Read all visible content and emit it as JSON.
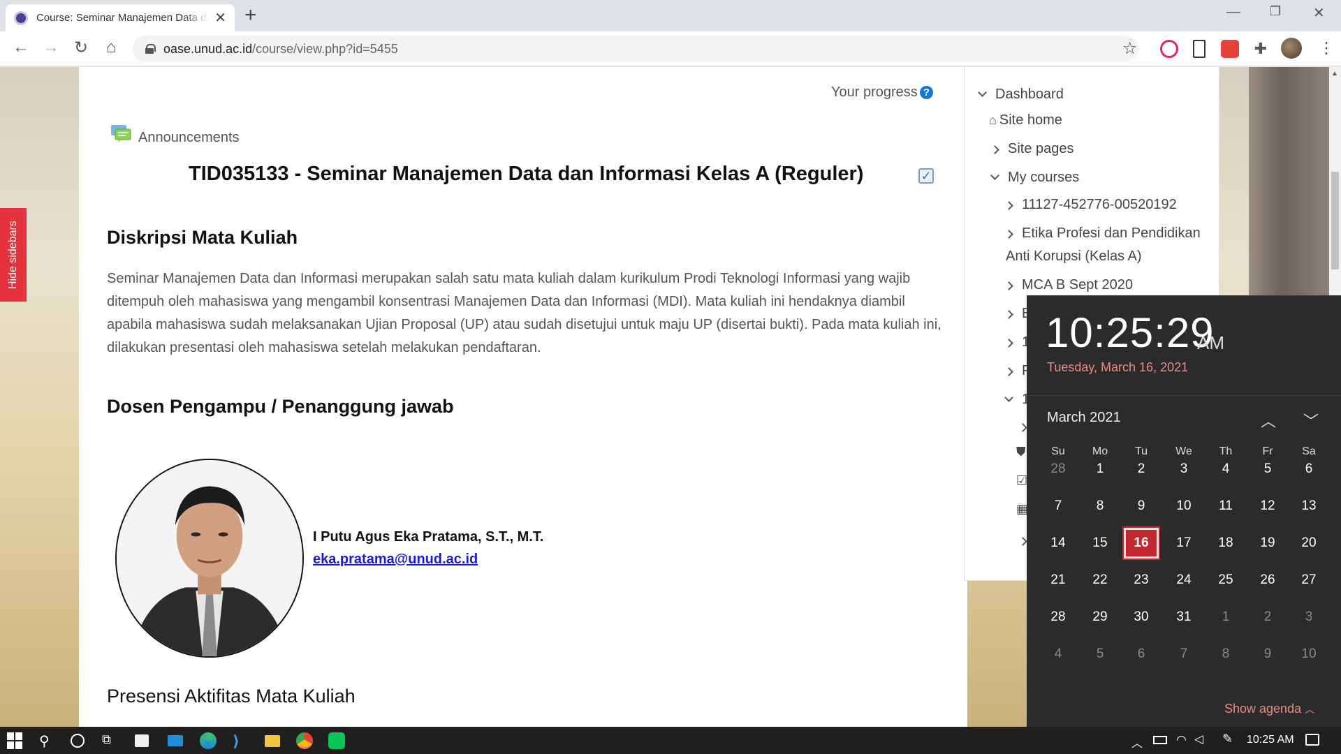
{
  "browser": {
    "tab_title": "Course: Seminar Manajemen Data dan Informasi",
    "url_host": "oase.unud.ac.id",
    "url_path": "/course/view.php?id=5455"
  },
  "page": {
    "hide_sidebars": "Hide sidebars",
    "progress_label": "Your progress",
    "announcements": "Announcements",
    "course_title": "TID035133 - Seminar Manajemen Data dan Informasi Kelas A (Reguler)",
    "desc_heading": "Diskripsi Mata Kuliah",
    "description": "Seminar Manajemen Data dan Informasi merupakan salah satu mata kuliah dalam kurikulum Prodi Teknologi Informasi yang wajib ditempuh oleh mahasiswa yang mengambil konsentrasi Manajemen Data dan Informasi (MDI). Mata kuliah ini hendaknya diambil apabila mahasiswa sudah melaksanakan Ujian Proposal (UP) atau sudah disetujui untuk maju UP (disertai bukti). Pada mata kuliah ini, dilakukan presentasi oleh mahasiswa setelah melakukan pendaftaran.",
    "lecturer_heading": "Dosen Pengampu / Penanggung jawab",
    "lecturer_name": "I Putu Agus Eka Pratama, S.T., M.T.",
    "lecturer_email": "eka.pratama@unud.ac.id",
    "presensi_heading": "Presensi Aktifitas Mata Kuliah"
  },
  "navigation": {
    "dashboard": "Dashboard",
    "site_home": "Site home",
    "site_pages": "Site pages",
    "my_courses": "My courses",
    "courses": [
      "11127-452776-00520192",
      "Etika Profesi dan Pendidikan",
      "Anti Korupsi (Kelas A)",
      "MCA B Sept 2020"
    ],
    "truncated_items": [
      "E",
      "1",
      "F",
      "1"
    ]
  },
  "calendar": {
    "time": "10:25:29",
    "ampm": "AM",
    "date_long": "Tuesday, March 16, 2021",
    "month": "March 2021",
    "dow": [
      "Su",
      "Mo",
      "Tu",
      "We",
      "Th",
      "Fr",
      "Sa"
    ],
    "weeks": [
      [
        "28",
        "1",
        "2",
        "3",
        "4",
        "5",
        "6"
      ],
      [
        "7",
        "8",
        "9",
        "10",
        "11",
        "12",
        "13"
      ],
      [
        "14",
        "15",
        "16",
        "17",
        "18",
        "19",
        "20"
      ],
      [
        "21",
        "22",
        "23",
        "24",
        "25",
        "26",
        "27"
      ],
      [
        "28",
        "29",
        "30",
        "31",
        "1",
        "2",
        "3"
      ],
      [
        "4",
        "5",
        "6",
        "7",
        "8",
        "9",
        "10"
      ]
    ],
    "today": "16",
    "show_agenda": "Show agenda"
  },
  "taskbar": {
    "time": "10:25 AM"
  },
  "colors": {
    "accent_red": "#c3272f",
    "link_blue": "#1a1adb"
  }
}
